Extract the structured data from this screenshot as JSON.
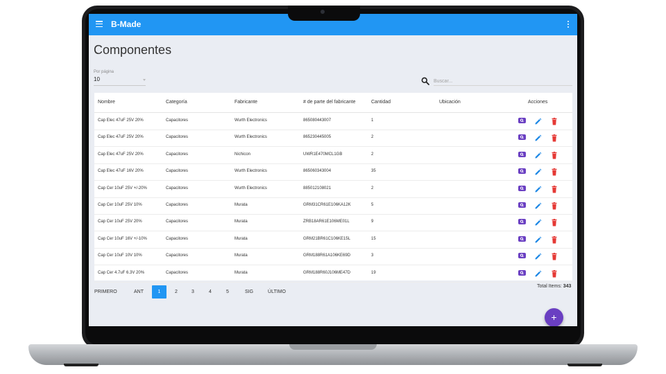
{
  "app": {
    "title": "B-Made"
  },
  "page": {
    "title": "Componentes"
  },
  "per_page": {
    "label": "Por página",
    "value": "10"
  },
  "search": {
    "placeholder": "Buscar..."
  },
  "table": {
    "headers": [
      "Nombre",
      "Categoría",
      "Fabricante",
      "# de parte del fabricante",
      "Cantidad",
      "Ubicación",
      "Acciones"
    ],
    "rows": [
      [
        "Cap Elec 47uF 25V 20%",
        "Capacitores",
        "Wurth Electronics",
        "865080443007",
        "1",
        ""
      ],
      [
        "Cap Elec 47uF 25V 20%",
        "Capacitores",
        "Wurth Electronics",
        "865230445005",
        "2",
        ""
      ],
      [
        "Cap Elec 47uF 25V 20%",
        "Capacitores",
        "Nichicon",
        "UWR1E470MCL1GB",
        "2",
        ""
      ],
      [
        "Cap Elec 47uF 16V 20%",
        "Capacitores",
        "Wurth Electronics",
        "865060343004",
        "35",
        ""
      ],
      [
        "Cap Cer 10uF 25V +/-20%",
        "Capacitores",
        "Wurth Electronics",
        "885012108021",
        "2",
        ""
      ],
      [
        "Cap Cer 10uF 25V 10%",
        "Capacitores",
        "Murata",
        "GRM31CR61E106KA12K",
        "5",
        ""
      ],
      [
        "Cap Cer 10uF 25V 20%",
        "Capacitores",
        "Murata",
        "ZRB18AR61E106ME01L",
        "9",
        ""
      ],
      [
        "Cap Cer 10uF 16V +/-10%",
        "Capacitores",
        "Murata",
        "GRM21BR61C106KE15L",
        "15",
        ""
      ],
      [
        "Cap Cer 10uF 10V 10%",
        "Capacitores",
        "Murata",
        "GRM188R61A106KE69D",
        "3",
        ""
      ],
      [
        "Cap Cer 4.7uF 6.3V 20%",
        "Capacitores",
        "Murata",
        "GRM188R60J106ME47D",
        "19",
        ""
      ]
    ]
  },
  "pagination": {
    "first": "PRIMERO",
    "prev": "ANT",
    "pages": [
      "1",
      "2",
      "3",
      "4",
      "5"
    ],
    "active_page": "1",
    "next": "SIG",
    "last": "ÚLTIMO"
  },
  "total": {
    "label": "Total Items:",
    "value": "343"
  },
  "fab": {
    "label": "+"
  },
  "colors": {
    "appbar": "#2196f3",
    "accent": "#6a3fc2",
    "edit": "#1e88e5",
    "delete": "#e53935",
    "background": "#eaedf3"
  }
}
